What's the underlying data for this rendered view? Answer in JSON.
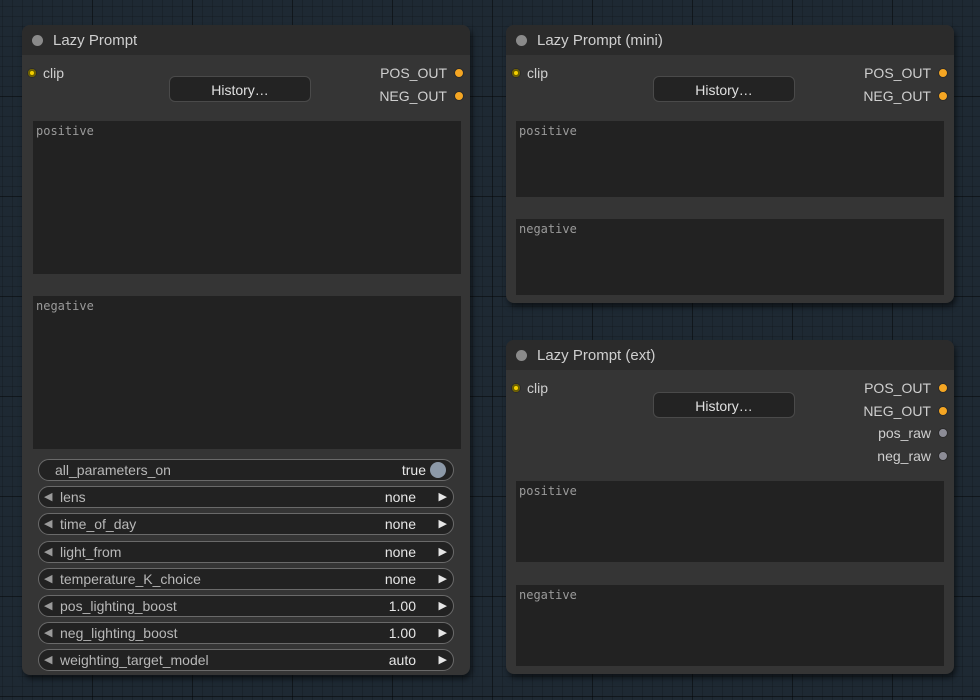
{
  "nodes": {
    "main": {
      "title": "Lazy Prompt",
      "input_clip": "clip",
      "history_label": "History…",
      "outputs": [
        "POS_OUT",
        "NEG_OUT"
      ],
      "positive_placeholder": "positive",
      "negative_placeholder": "negative",
      "widgets": [
        {
          "name": "all_parameters_on",
          "value": "true"
        },
        {
          "name": "lens",
          "value": "none"
        },
        {
          "name": "time_of_day",
          "value": "none"
        },
        {
          "name": "light_from",
          "value": "none"
        },
        {
          "name": "temperature_K_choice",
          "value": "none"
        },
        {
          "name": "pos_lighting_boost",
          "value": "1.00"
        },
        {
          "name": "neg_lighting_boost",
          "value": "1.00"
        },
        {
          "name": "weighting_target_model",
          "value": "auto"
        }
      ]
    },
    "mini": {
      "title": "Lazy Prompt (mini)",
      "input_clip": "clip",
      "history_label": "History…",
      "outputs": [
        "POS_OUT",
        "NEG_OUT"
      ],
      "positive_placeholder": "positive",
      "negative_placeholder": "negative"
    },
    "ext": {
      "title": "Lazy Prompt (ext)",
      "input_clip": "clip",
      "history_label": "History…",
      "outputs": [
        "POS_OUT",
        "NEG_OUT",
        "pos_raw",
        "neg_raw"
      ],
      "positive_placeholder": "positive",
      "negative_placeholder": "negative"
    }
  },
  "colors": {
    "canvas": "#1e2933",
    "node_body": "#353535",
    "node_title": "#2b2b2b",
    "clip_slot": "#f5d000",
    "conditioning_slot": "#f5a623",
    "string_slot": "#8c8c96"
  }
}
